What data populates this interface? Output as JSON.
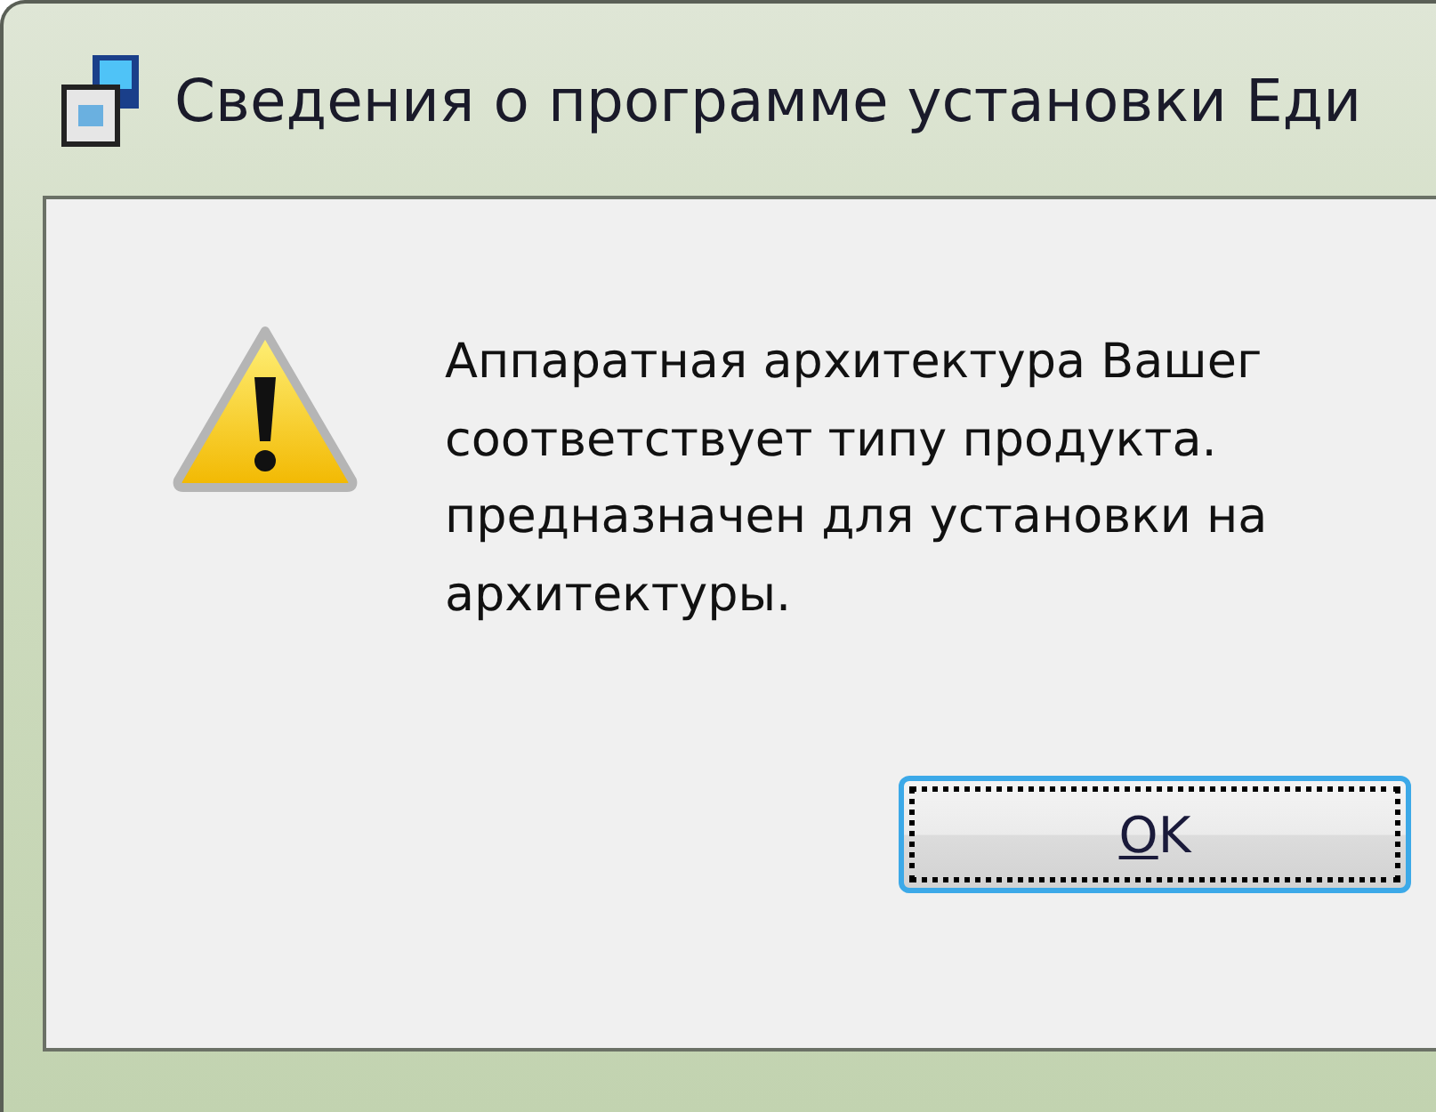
{
  "window": {
    "title": "Сведения о программе установки Еди"
  },
  "message": {
    "lines": [
      "Аппаратная архитектура Вашег",
      "соответствует типу продукта.",
      "предназначен для установки на",
      "архитектуры."
    ]
  },
  "buttons": [
    {
      "label": "OK",
      "focused": true
    }
  ]
}
